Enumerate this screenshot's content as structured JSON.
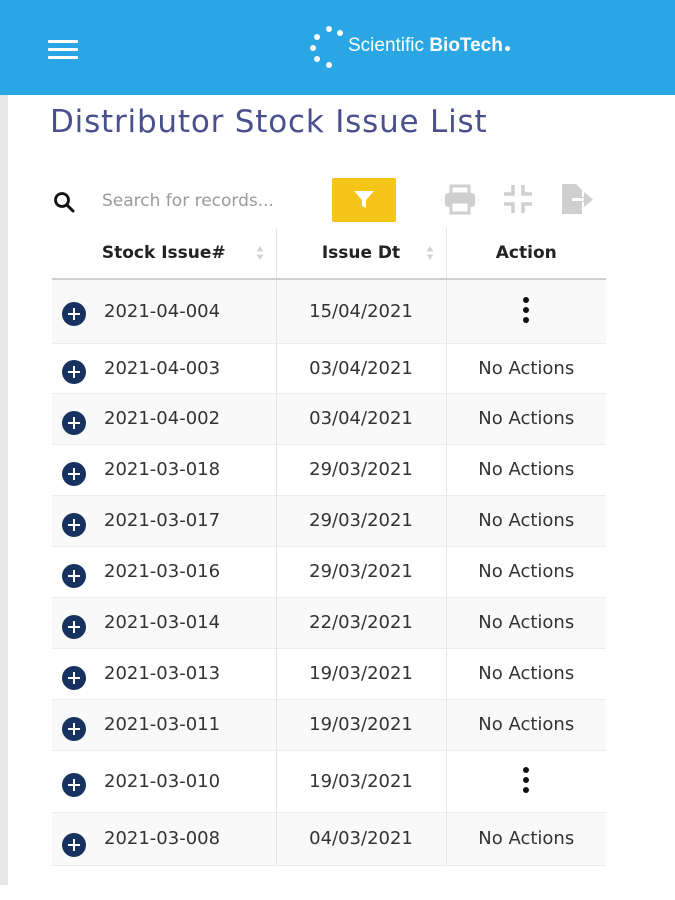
{
  "header": {
    "brand_part1": "Scientific",
    "brand_part2": "BioTech",
    "icons": [
      "menu-icon",
      "brand-logo"
    ],
    "color": "#29a6e3"
  },
  "page": {
    "title": "Distributor Stock Issue List"
  },
  "toolbar": {
    "search_placeholder": "Search for records...",
    "search_value": "",
    "filter_color": "#f5c518",
    "icons": [
      "search-icon",
      "filter-icon",
      "print-icon",
      "collapse-icon",
      "export-icon"
    ]
  },
  "table": {
    "columns": [
      "Stock Issue#",
      "Issue Dt",
      "Action"
    ],
    "rows": [
      {
        "id": "2021-04-004",
        "date": "15/04/2021",
        "action": ""
      },
      {
        "id": "2021-04-003",
        "date": "03/04/2021",
        "action": "No Actions"
      },
      {
        "id": "2021-04-002",
        "date": "03/04/2021",
        "action": "No Actions"
      },
      {
        "id": "2021-03-018",
        "date": "29/03/2021",
        "action": "No Actions"
      },
      {
        "id": "2021-03-017",
        "date": "29/03/2021",
        "action": "No Actions"
      },
      {
        "id": "2021-03-016",
        "date": "29/03/2021",
        "action": "No Actions"
      },
      {
        "id": "2021-03-014",
        "date": "22/03/2021",
        "action": "No Actions"
      },
      {
        "id": "2021-03-013",
        "date": "19/03/2021",
        "action": "No Actions"
      },
      {
        "id": "2021-03-011",
        "date": "19/03/2021",
        "action": "No Actions"
      },
      {
        "id": "2021-03-010",
        "date": "19/03/2021",
        "action": ""
      },
      {
        "id": "2021-03-008",
        "date": "04/03/2021",
        "action": "No Actions"
      }
    ]
  }
}
